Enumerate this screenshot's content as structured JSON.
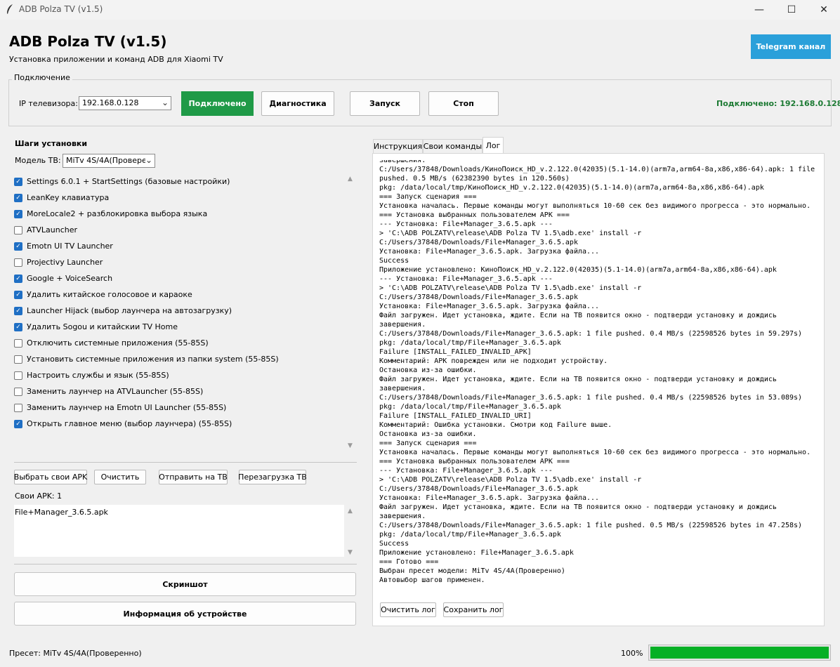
{
  "window": {
    "title": "ADB Polza TV (v1.5)",
    "controls": {
      "minimize": "—",
      "maximize": "☐",
      "close": "✕"
    }
  },
  "header": {
    "title": "ADB Polza TV (v1.5)",
    "subtitle": "Установка приложении и команд ADB для Xiaomi TV",
    "telegram_button": "Telegram канал",
    "telegram_color": "#2aa0da"
  },
  "connection": {
    "group_label": "Подключение",
    "ip_label": "IP телевизора:",
    "ip_value": "192.168.0.128",
    "connected_button": "Подключено",
    "connected_color": "#1f9a47",
    "diagnostics_button": "Диагностика",
    "start_button": "Запуск",
    "stop_button": "Стоп",
    "status_text": "Подключено: 192.168.0.128"
  },
  "steps": {
    "title": "Шаги установки",
    "model_label": "Модель ТВ:",
    "model_value": "MiTv 4S/4A(Проверен",
    "items": [
      {
        "label": "Settings 6.0.1 + StartSettings (базовые настройки)",
        "checked": true
      },
      {
        "label": "LeanKey клавиатура",
        "checked": true
      },
      {
        "label": "MoreLocale2 + разблокировка выбора языка",
        "checked": true
      },
      {
        "label": "ATVLauncher",
        "checked": false
      },
      {
        "label": "Emotn UI TV Launcher",
        "checked": true
      },
      {
        "label": "Projectivy Launcher",
        "checked": false
      },
      {
        "label": "Google + VoiceSearch",
        "checked": true
      },
      {
        "label": "Удалить китайское голосовое и караоке",
        "checked": true
      },
      {
        "label": "Launcher Hijack (выбор лаунчера на автозагрузку)",
        "checked": true
      },
      {
        "label": "Удалить Sogou и китайскии TV Home",
        "checked": true
      },
      {
        "label": "Отключить системные приложения (55-85S)",
        "checked": false
      },
      {
        "label": "Установить системные приложения из папки system (55-85S)",
        "checked": false
      },
      {
        "label": "Настроить службы и язык (55-85S)",
        "checked": false
      },
      {
        "label": "Заменить лаунчер на ATVLauncher (55-85S)",
        "checked": false
      },
      {
        "label": "Заменить лаунчер на Emotn UI Launcher (55-85S)",
        "checked": false
      },
      {
        "label": "Открыть главное меню (выбор лаунчера) (55-85S)",
        "checked": true
      }
    ]
  },
  "apk": {
    "choose_button": "Выбрать свои APK",
    "clear_button": "Очистить",
    "send_button": "Отправить на ТВ",
    "reboot_button": "Перезагрузка ТВ",
    "count_label": "Свои APK: 1",
    "files": [
      "File+Manager_3.6.5.apk"
    ]
  },
  "actions": {
    "screenshot_button": "Скриншот",
    "device_info_button": "Информация об устройстве"
  },
  "tabs": [
    {
      "label": "Инструкция",
      "active": false
    },
    {
      "label": "Свои команды",
      "active": false
    },
    {
      "label": "Лог",
      "active": true
    }
  ],
  "log": {
    "lines": [
      "завершения.",
      "C:/Users/37848/Downloads/КиноПоиск_HD_v.2.122.0(42035)(5.1-14.0)(arm7a,arm64-8a,x86,x86-64).apk: 1 file",
      "pushed. 0.5 MB/s (62382390 bytes in 120.560s)",
      "pkg: /data/local/tmp/КиноПоиск_HD_v.2.122.0(42035)(5.1-14.0)(arm7a,arm64-8a,x86,x86-64).apk",
      "=== Запуск сценария ===",
      "Установка началась. Первые команды могут выполняться 10-60 сек без видимого прогресса - это нормально.",
      "=== Установка выбранных пользователем APK ===",
      "--- Установка: File+Manager_3.6.5.apk ---",
      "> 'C:\\ADB POLZATV\\release\\ADB Polza TV 1.5\\adb.exe' install -r",
      "C:/Users/37848/Downloads/File+Manager_3.6.5.apk",
      "Установка: File+Manager_3.6.5.apk. Загрузка файла...",
      "Success",
      "Приложение установлено: КиноПоиск_HD_v.2.122.0(42035)(5.1-14.0)(arm7a,arm64-8a,x86,x86-64).apk",
      "--- Установка: File+Manager_3.6.5.apk ---",
      "> 'C:\\ADB POLZATV\\release\\ADB Polza TV 1.5\\adb.exe' install -r",
      "C:/Users/37848/Downloads/File+Manager_3.6.5.apk",
      "Установка: File+Manager_3.6.5.apk. Загрузка файла...",
      "Файл загружен. Идет установка, ждите. Если на ТВ появится окно - подтверди установку и дождись",
      "завершения.",
      "C:/Users/37848/Downloads/File+Manager_3.6.5.apk: 1 file pushed. 0.4 MB/s (22598526 bytes in 59.297s)",
      "pkg: /data/local/tmp/File+Manager_3.6.5.apk",
      "Failure [INSTALL_FAILED_INVALID_APK]",
      "Комментарий: APK поврежден или не подходит устройству.",
      "Остановка из-за ошибки.",
      "Файл загружен. Идет установка, ждите. Если на ТВ появится окно - подтверди установку и дождись",
      "завершения.",
      "C:/Users/37848/Downloads/File+Manager_3.6.5.apk: 1 file pushed. 0.4 MB/s (22598526 bytes in 53.089s)",
      "pkg: /data/local/tmp/File+Manager_3.6.5.apk",
      "Failure [INSTALL_FAILED_INVALID_URI]",
      "Комментарий: Ошибка установки. Смотри код Failure выше.",
      "Остановка из-за ошибки.",
      "=== Запуск сценария ===",
      "Установка началась. Первые команды могут выполняться 10-60 сек без видимого прогресса - это нормально.",
      "=== Установка выбранных пользователем APK ===",
      "--- Установка: File+Manager_3.6.5.apk ---",
      "> 'C:\\ADB POLZATV\\release\\ADB Polza TV 1.5\\adb.exe' install -r",
      "C:/Users/37848/Downloads/File+Manager_3.6.5.apk",
      "Установка: File+Manager_3.6.5.apk. Загрузка файла...",
      "Файл загружен. Идет установка, ждите. Если на ТВ появится окно - подтверди установку и дождись",
      "завершения.",
      "C:/Users/37848/Downloads/File+Manager_3.6.5.apk: 1 file pushed. 0.5 MB/s (22598526 bytes in 47.258s)",
      "pkg: /data/local/tmp/File+Manager_3.6.5.apk",
      "Success",
      "Приложение установлено: File+Manager_3.6.5.apk",
      "=== Готово ===",
      "Выбран пресет модели: MiTv 4S/4A(Проверенно)",
      "Автовыбор шагов применен."
    ],
    "clear_button": "Очистить лог",
    "save_button": "Сохранить лог"
  },
  "footer": {
    "preset_label": "Пресет: MiTv 4S/4A(Проверенно)",
    "progress_text": "100%",
    "progress_fraction": 1.0,
    "progress_color": "#06b025"
  }
}
